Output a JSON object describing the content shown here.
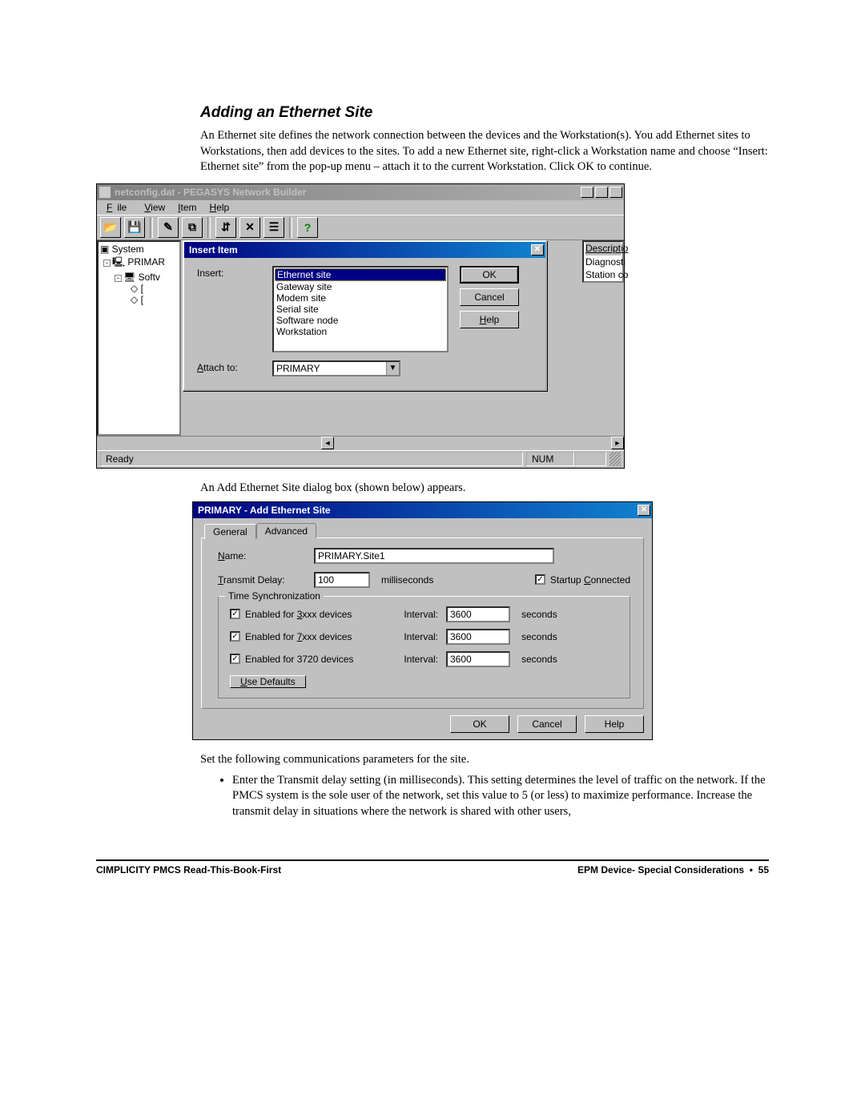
{
  "section": {
    "title": "Adding an Ethernet Site",
    "para1": "An Ethernet site defines the network connection between the devices and the Workstation(s). You add Ethernet sites to Workstations, then add devices to the sites. To add a new Ethernet site, right-click a Workstation name and choose “Insert: Ethernet site” from the pop-up menu – attach it to the current Workstation. Click OK to continue.",
    "caption2": "An Add Ethernet Site dialog box (shown below) appears.",
    "para3": "Set the following communications parameters for the site.",
    "bullet1": "Enter the Transmit delay setting (in milliseconds). This setting determines the level of traffic on the network. If the PMCS system is the sole user of the network, set this value to 5 (or less) to maximize performance. Increase the transmit delay in situations where the network is shared with other users,"
  },
  "shot1": {
    "title": "netconfig.dat - PEGASYS Network Builder",
    "menus": {
      "file": "File",
      "view": "View",
      "item": "Item",
      "help": "Help"
    },
    "toolbar_open": "📂",
    "toolbar_save": "💾",
    "toolbar_q": "?",
    "toolbar_x": "✕",
    "tree": {
      "root": "System",
      "n1": "PRIMAR",
      "n2": "Softv",
      "n3": "[",
      "n4": "["
    },
    "right_headers": [
      "Descriptio",
      "Diagnosti",
      "Station co"
    ],
    "dialog": {
      "title": "Insert Item",
      "insert_label": "Insert:",
      "options": [
        "Ethernet site",
        "Gateway site",
        "Modem site",
        "Serial site",
        "Software node",
        "Workstation"
      ],
      "attach_label": "Attach to:",
      "attach_value": "PRIMARY",
      "ok": "OK",
      "cancel": "Cancel",
      "help": "Help"
    },
    "status_ready": "Ready",
    "status_num": "NUM"
  },
  "shot2": {
    "title": "PRIMARY - Add Ethernet Site",
    "tabs": {
      "general": "General",
      "advanced": "Advanced"
    },
    "name_label": "Name:",
    "name_value": "PRIMARY.Site1",
    "delay_label": "Transmit Delay:",
    "delay_value": "100",
    "delay_unit": "milliseconds",
    "startup_label": "Startup Connected",
    "sync_legend": "Time Synchronization",
    "sync_rows": [
      {
        "label": "Enabled for 3xxx devices",
        "interval_label": "Interval:",
        "value": "3600",
        "unit": "seconds"
      },
      {
        "label": "Enabled for 7xxx devices",
        "interval_label": "Interval:",
        "value": "3600",
        "unit": "seconds"
      },
      {
        "label": "Enabled for 3720 devices",
        "interval_label": "Interval:",
        "value": "3600",
        "unit": "seconds"
      }
    ],
    "defaults_btn": "Use Defaults",
    "ok": "OK",
    "cancel": "Cancel",
    "help": "Help"
  },
  "footer": {
    "left": "CIMPLICITY PMCS Read-This-Book-First",
    "right_label": "EPM Device- Special Considerations",
    "page": "55"
  }
}
